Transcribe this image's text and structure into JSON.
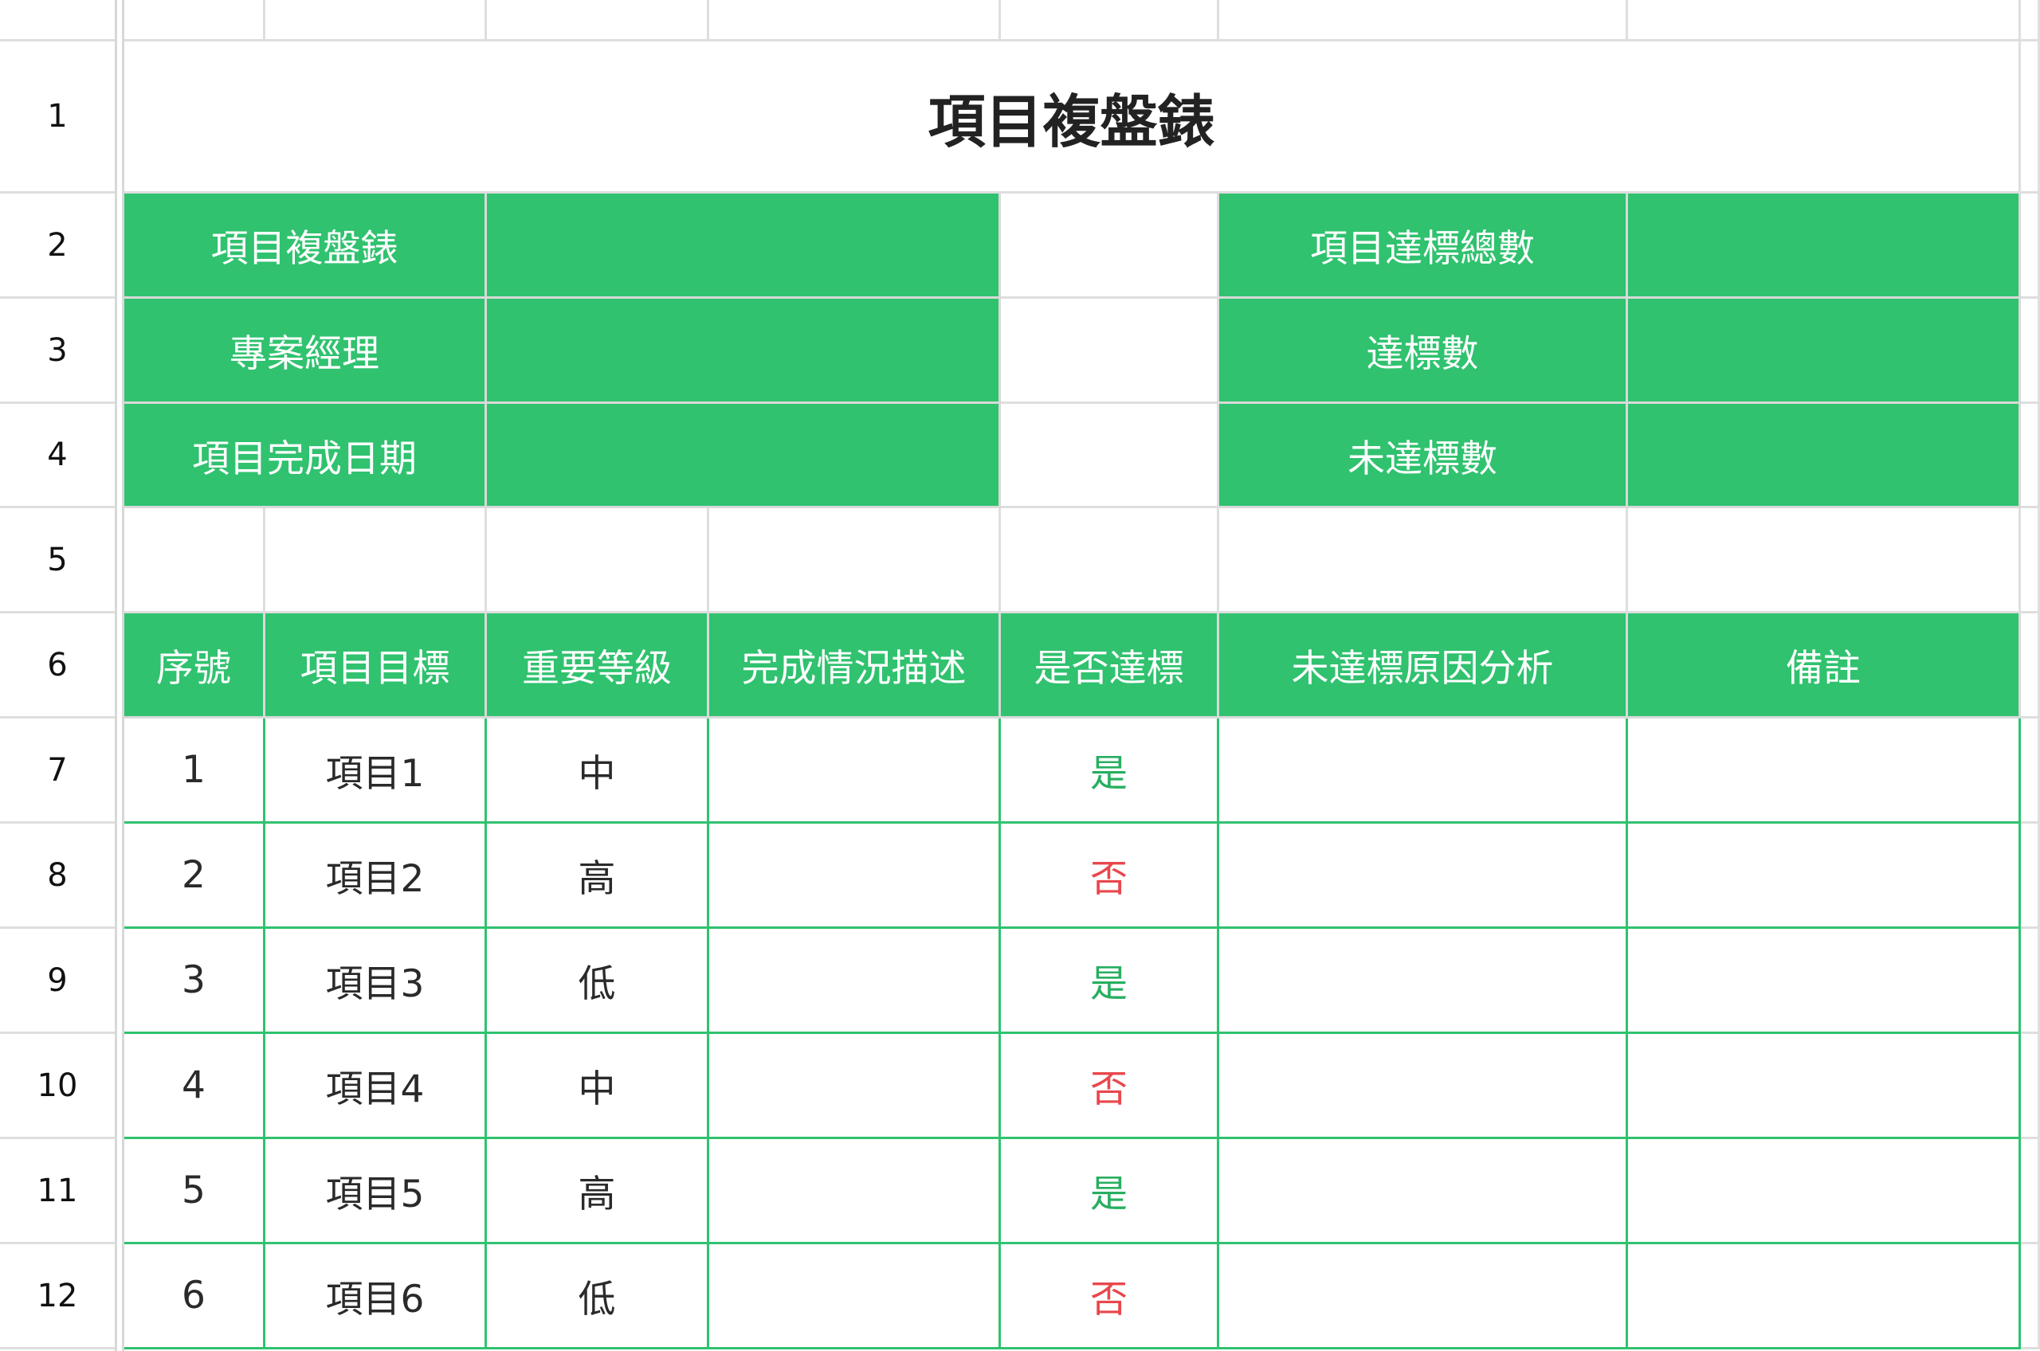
{
  "row_headers": [
    "1",
    "2",
    "3",
    "4",
    "5",
    "6",
    "7",
    "8",
    "9",
    "10",
    "11",
    "12"
  ],
  "title": "項目複盤錶",
  "summary": {
    "left_labels": [
      "項目複盤錶",
      "專案經理",
      "項目完成日期"
    ],
    "right_labels": [
      "項目達標總數",
      "達標數",
      "未達標數"
    ]
  },
  "table": {
    "headers": [
      "序號",
      "項目目標",
      "重要等級",
      "完成情況描述",
      "是否達標",
      "未達標原因分析",
      "備註"
    ],
    "rows": [
      {
        "no": "1",
        "goal": "項目1",
        "level": "中",
        "desc": "",
        "met": "是",
        "reason": "",
        "note": ""
      },
      {
        "no": "2",
        "goal": "項目2",
        "level": "高",
        "desc": "",
        "met": "否",
        "reason": "",
        "note": ""
      },
      {
        "no": "3",
        "goal": "項目3",
        "level": "低",
        "desc": "",
        "met": "是",
        "reason": "",
        "note": ""
      },
      {
        "no": "4",
        "goal": "項目4",
        "level": "中",
        "desc": "",
        "met": "否",
        "reason": "",
        "note": ""
      },
      {
        "no": "5",
        "goal": "項目5",
        "level": "高",
        "desc": "",
        "met": "是",
        "reason": "",
        "note": ""
      },
      {
        "no": "6",
        "goal": "項目6",
        "level": "低",
        "desc": "",
        "met": "否",
        "reason": "",
        "note": ""
      }
    ]
  },
  "colors": {
    "header_green": "#30c26f",
    "yes": "#27ae60",
    "no": "#e8474c"
  }
}
